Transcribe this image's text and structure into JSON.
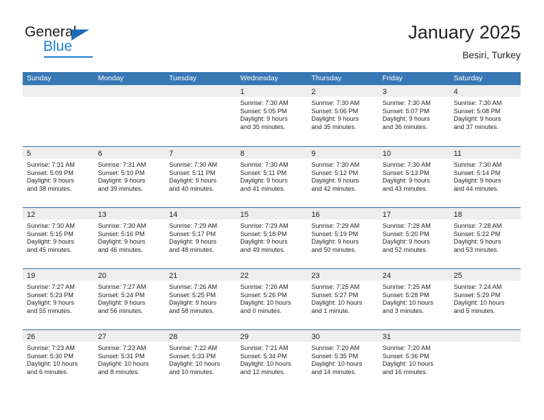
{
  "logo": {
    "word1": "General",
    "word2": "Blue",
    "accent_color": "#1b7fd4",
    "triangle_color": "#1b6cb5"
  },
  "header": {
    "title": "January 2025",
    "subtitle": "Besiri, Turkey"
  },
  "theme": {
    "header_bar_color": "#3878b4",
    "week_divider_color": "#2a6cab",
    "day_band_color": "#eeeeee",
    "text_color": "#231f20"
  },
  "calendar": {
    "weekdays": [
      "Sunday",
      "Monday",
      "Tuesday",
      "Wednesday",
      "Thursday",
      "Friday",
      "Saturday"
    ],
    "weeks": [
      [
        {
          "day": "",
          "lines": []
        },
        {
          "day": "",
          "lines": []
        },
        {
          "day": "",
          "lines": []
        },
        {
          "day": "1",
          "lines": [
            "Sunrise: 7:30 AM",
            "Sunset: 5:05 PM",
            "Daylight: 9 hours",
            "and 35 minutes."
          ]
        },
        {
          "day": "2",
          "lines": [
            "Sunrise: 7:30 AM",
            "Sunset: 5:06 PM",
            "Daylight: 9 hours",
            "and 35 minutes."
          ]
        },
        {
          "day": "3",
          "lines": [
            "Sunrise: 7:30 AM",
            "Sunset: 5:07 PM",
            "Daylight: 9 hours",
            "and 36 minutes."
          ]
        },
        {
          "day": "4",
          "lines": [
            "Sunrise: 7:30 AM",
            "Sunset: 5:08 PM",
            "Daylight: 9 hours",
            "and 37 minutes."
          ]
        }
      ],
      [
        {
          "day": "5",
          "lines": [
            "Sunrise: 7:31 AM",
            "Sunset: 5:09 PM",
            "Daylight: 9 hours",
            "and 38 minutes."
          ]
        },
        {
          "day": "6",
          "lines": [
            "Sunrise: 7:31 AM",
            "Sunset: 5:10 PM",
            "Daylight: 9 hours",
            "and 39 minutes."
          ]
        },
        {
          "day": "7",
          "lines": [
            "Sunrise: 7:30 AM",
            "Sunset: 5:11 PM",
            "Daylight: 9 hours",
            "and 40 minutes."
          ]
        },
        {
          "day": "8",
          "lines": [
            "Sunrise: 7:30 AM",
            "Sunset: 5:11 PM",
            "Daylight: 9 hours",
            "and 41 minutes."
          ]
        },
        {
          "day": "9",
          "lines": [
            "Sunrise: 7:30 AM",
            "Sunset: 5:12 PM",
            "Daylight: 9 hours",
            "and 42 minutes."
          ]
        },
        {
          "day": "10",
          "lines": [
            "Sunrise: 7:30 AM",
            "Sunset: 5:13 PM",
            "Daylight: 9 hours",
            "and 43 minutes."
          ]
        },
        {
          "day": "11",
          "lines": [
            "Sunrise: 7:30 AM",
            "Sunset: 5:14 PM",
            "Daylight: 9 hours",
            "and 44 minutes."
          ]
        }
      ],
      [
        {
          "day": "12",
          "lines": [
            "Sunrise: 7:30 AM",
            "Sunset: 5:15 PM",
            "Daylight: 9 hours",
            "and 45 minutes."
          ]
        },
        {
          "day": "13",
          "lines": [
            "Sunrise: 7:30 AM",
            "Sunset: 5:16 PM",
            "Daylight: 9 hours",
            "and 46 minutes."
          ]
        },
        {
          "day": "14",
          "lines": [
            "Sunrise: 7:29 AM",
            "Sunset: 5:17 PM",
            "Daylight: 9 hours",
            "and 48 minutes."
          ]
        },
        {
          "day": "15",
          "lines": [
            "Sunrise: 7:29 AM",
            "Sunset: 5:18 PM",
            "Daylight: 9 hours",
            "and 49 minutes."
          ]
        },
        {
          "day": "16",
          "lines": [
            "Sunrise: 7:29 AM",
            "Sunset: 5:19 PM",
            "Daylight: 9 hours",
            "and 50 minutes."
          ]
        },
        {
          "day": "17",
          "lines": [
            "Sunrise: 7:28 AM",
            "Sunset: 5:20 PM",
            "Daylight: 9 hours",
            "and 52 minutes."
          ]
        },
        {
          "day": "18",
          "lines": [
            "Sunrise: 7:28 AM",
            "Sunset: 5:22 PM",
            "Daylight: 9 hours",
            "and 53 minutes."
          ]
        }
      ],
      [
        {
          "day": "19",
          "lines": [
            "Sunrise: 7:27 AM",
            "Sunset: 5:23 PM",
            "Daylight: 9 hours",
            "and 55 minutes."
          ]
        },
        {
          "day": "20",
          "lines": [
            "Sunrise: 7:27 AM",
            "Sunset: 5:24 PM",
            "Daylight: 9 hours",
            "and 56 minutes."
          ]
        },
        {
          "day": "21",
          "lines": [
            "Sunrise: 7:26 AM",
            "Sunset: 5:25 PM",
            "Daylight: 9 hours",
            "and 58 minutes."
          ]
        },
        {
          "day": "22",
          "lines": [
            "Sunrise: 7:26 AM",
            "Sunset: 5:26 PM",
            "Daylight: 10 hours",
            "and 0 minutes."
          ]
        },
        {
          "day": "23",
          "lines": [
            "Sunrise: 7:25 AM",
            "Sunset: 5:27 PM",
            "Daylight: 10 hours",
            "and 1 minute."
          ]
        },
        {
          "day": "24",
          "lines": [
            "Sunrise: 7:25 AM",
            "Sunset: 5:28 PM",
            "Daylight: 10 hours",
            "and 3 minutes."
          ]
        },
        {
          "day": "25",
          "lines": [
            "Sunrise: 7:24 AM",
            "Sunset: 5:29 PM",
            "Daylight: 10 hours",
            "and 5 minutes."
          ]
        }
      ],
      [
        {
          "day": "26",
          "lines": [
            "Sunrise: 7:23 AM",
            "Sunset: 5:30 PM",
            "Daylight: 10 hours",
            "and 6 minutes."
          ]
        },
        {
          "day": "27",
          "lines": [
            "Sunrise: 7:23 AM",
            "Sunset: 5:31 PM",
            "Daylight: 10 hours",
            "and 8 minutes."
          ]
        },
        {
          "day": "28",
          "lines": [
            "Sunrise: 7:22 AM",
            "Sunset: 5:33 PM",
            "Daylight: 10 hours",
            "and 10 minutes."
          ]
        },
        {
          "day": "29",
          "lines": [
            "Sunrise: 7:21 AM",
            "Sunset: 5:34 PM",
            "Daylight: 10 hours",
            "and 12 minutes."
          ]
        },
        {
          "day": "30",
          "lines": [
            "Sunrise: 7:20 AM",
            "Sunset: 5:35 PM",
            "Daylight: 10 hours",
            "and 14 minutes."
          ]
        },
        {
          "day": "31",
          "lines": [
            "Sunrise: 7:20 AM",
            "Sunset: 5:36 PM",
            "Daylight: 10 hours",
            "and 16 minutes."
          ]
        },
        {
          "day": "",
          "lines": []
        }
      ]
    ]
  }
}
